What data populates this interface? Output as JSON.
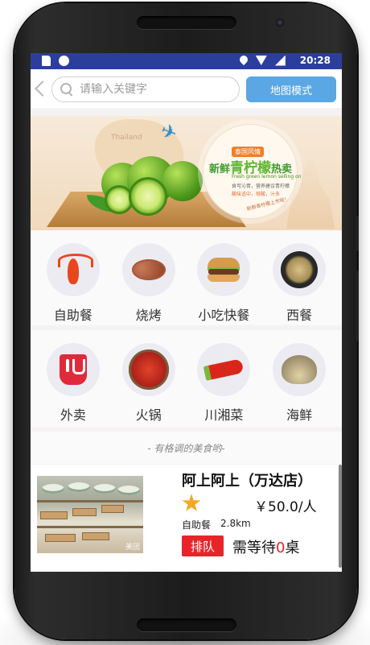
{
  "status_bar": {
    "time": "20:28"
  },
  "search": {
    "placeholder": "请输入关键字",
    "map_button_label": "地图模式"
  },
  "banner": {
    "map_label": "Thailand",
    "tag": "泰国风情",
    "headline_pre": "新鲜",
    "headline_big": "青柠檬",
    "headline_post": "热卖",
    "subtitle": "Fresh green lemon selling on",
    "line1": "食可沁胃，营养建议青柠檬",
    "line2": "酸味适中，够酸，汁多",
    "sign": "新鲜青柠檬上市啦！"
  },
  "categories_row1": [
    {
      "label": "自助餐",
      "icon": "lobster-icon"
    },
    {
      "label": "烧烤",
      "icon": "bbq-meat-icon"
    },
    {
      "label": "小吃快餐",
      "icon": "burger-icon"
    },
    {
      "label": "西餐",
      "icon": "western-plate-icon"
    }
  ],
  "categories_row2": [
    {
      "label": "外卖",
      "icon": "takeout-icon"
    },
    {
      "label": "火锅",
      "icon": "hotpot-icon"
    },
    {
      "label": "川湘菜",
      "icon": "chili-icon"
    },
    {
      "label": "海鲜",
      "icon": "seafood-shell-icon"
    }
  ],
  "slogan": "- 有格调的美食哟-",
  "restaurant": {
    "name": "阿上阿上（万达店）",
    "price": "￥50.0/人",
    "category": "自助餐",
    "distance": "2.8km",
    "queue_label": "排队",
    "wait_prefix": "需等待",
    "wait_count": "0",
    "wait_suffix": "桌",
    "photo_watermark": "美团"
  },
  "colors": {
    "status_bar": "#2c3e9c",
    "map_button": "#5aa7e4",
    "queue_badge": "#e8242a",
    "star": "#f5a623"
  }
}
